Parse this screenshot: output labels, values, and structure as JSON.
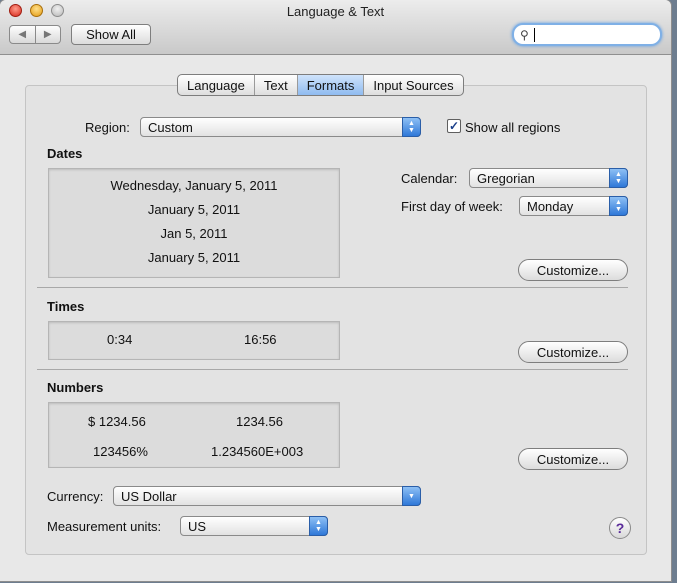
{
  "window": {
    "title": "Language & Text"
  },
  "toolbar": {
    "show_all_label": "Show All"
  },
  "tabs": [
    {
      "label": "Language",
      "active": false
    },
    {
      "label": "Text",
      "active": false
    },
    {
      "label": "Formats",
      "active": true
    },
    {
      "label": "Input Sources",
      "active": false
    }
  ],
  "region": {
    "label": "Region:",
    "value": "Custom",
    "show_all_label": "Show all regions",
    "show_all_checked": true
  },
  "dates": {
    "heading": "Dates",
    "samples": [
      "Wednesday, January 5, 2011",
      "January 5, 2011",
      "Jan 5, 2011",
      "January 5, 2011"
    ],
    "calendar_label": "Calendar:",
    "calendar_value": "Gregorian",
    "first_day_label": "First day of week:",
    "first_day_value": "Monday",
    "customize_label": "Customize..."
  },
  "times": {
    "heading": "Times",
    "short": "0:34",
    "long": "16:56",
    "customize_label": "Customize..."
  },
  "numbers": {
    "heading": "Numbers",
    "currency_sample": "$ 1234.56",
    "decimal_sample": "1234.56",
    "percent_sample": "123456%",
    "scientific_sample": "1.234560E+003",
    "customize_label": "Customize..."
  },
  "currency": {
    "label": "Currency:",
    "value": "US Dollar"
  },
  "measurement": {
    "label": "Measurement units:",
    "value": "US"
  },
  "colors": {
    "accent": "#3b82e0",
    "active_tab": "#a9cdf6"
  }
}
